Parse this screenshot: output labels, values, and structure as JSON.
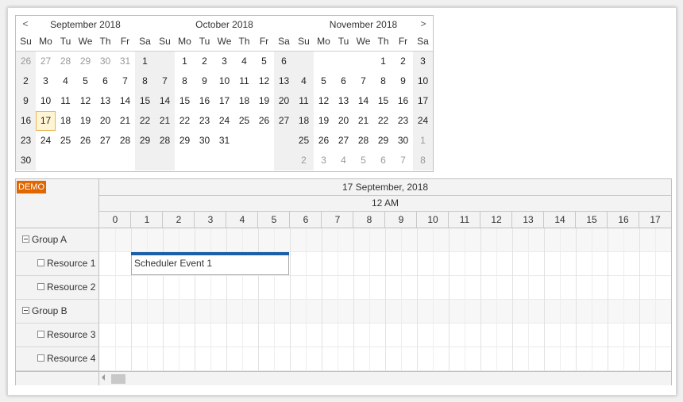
{
  "navigator": {
    "prev_label": "<",
    "next_label": ">",
    "months": [
      {
        "title": "September 2018",
        "weekdays": [
          "Su",
          "Mo",
          "Tu",
          "We",
          "Th",
          "Fr",
          "Sa"
        ],
        "weeks": [
          [
            "26",
            "27",
            "28",
            "29",
            "30",
            "31",
            "1"
          ],
          [
            "2",
            "3",
            "4",
            "5",
            "6",
            "7",
            "8"
          ],
          [
            "9",
            "10",
            "11",
            "12",
            "13",
            "14",
            "15"
          ],
          [
            "16",
            "17",
            "18",
            "19",
            "20",
            "21",
            "22"
          ],
          [
            "23",
            "24",
            "25",
            "26",
            "27",
            "28",
            "29"
          ],
          [
            "30",
            "",
            "",
            "",
            "",
            "",
            ""
          ]
        ]
      },
      {
        "title": "October 2018",
        "weekdays": [
          "Su",
          "Mo",
          "Tu",
          "We",
          "Th",
          "Fr",
          "Sa"
        ],
        "weeks": [
          [
            "",
            "1",
            "2",
            "3",
            "4",
            "5",
            "6"
          ],
          [
            "7",
            "8",
            "9",
            "10",
            "11",
            "12",
            "13"
          ],
          [
            "14",
            "15",
            "16",
            "17",
            "18",
            "19",
            "20"
          ],
          [
            "21",
            "22",
            "23",
            "24",
            "25",
            "26",
            "27"
          ],
          [
            "28",
            "29",
            "30",
            "31",
            "",
            "",
            ""
          ],
          [
            "",
            "",
            "",
            "",
            "",
            "",
            ""
          ]
        ]
      },
      {
        "title": "November 2018",
        "weekdays": [
          "Su",
          "Mo",
          "Tu",
          "We",
          "Th",
          "Fr",
          "Sa"
        ],
        "weeks": [
          [
            "",
            "",
            "",
            "",
            "1",
            "2",
            "3"
          ],
          [
            "4",
            "5",
            "6",
            "7",
            "8",
            "9",
            "10"
          ],
          [
            "11",
            "12",
            "13",
            "14",
            "15",
            "16",
            "17"
          ],
          [
            "18",
            "19",
            "20",
            "21",
            "22",
            "23",
            "24"
          ],
          [
            "25",
            "26",
            "27",
            "28",
            "29",
            "30",
            "1"
          ],
          [
            "2",
            "3",
            "4",
            "5",
            "6",
            "7",
            "8"
          ]
        ]
      }
    ]
  },
  "scheduler": {
    "badge": "DEMO",
    "date_header": "17 September, 2018",
    "period_header": "12 AM",
    "ticks": [
      "0",
      "1",
      "2",
      "3",
      "4",
      "5",
      "6",
      "7",
      "8",
      "9",
      "10",
      "11",
      "12",
      "13",
      "14",
      "15",
      "16",
      "17"
    ],
    "rows": [
      {
        "label": "Group A",
        "type": "group"
      },
      {
        "label": "Resource 1",
        "type": "resource"
      },
      {
        "label": "Resource 2",
        "type": "resource"
      },
      {
        "label": "Group B",
        "type": "group"
      },
      {
        "label": "Resource 3",
        "type": "resource"
      },
      {
        "label": "Resource 4",
        "type": "resource"
      }
    ],
    "event": {
      "text": "Scheduler Event 1",
      "bar_color": "#1c5fa8"
    }
  },
  "colors": {
    "badge": "#e06600",
    "today_highlight": "#fff5d4",
    "event_bar": "#1c5fa8"
  }
}
